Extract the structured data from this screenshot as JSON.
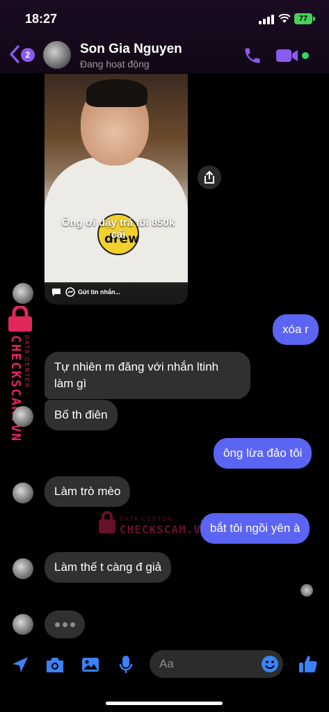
{
  "status_bar": {
    "time": "18:27",
    "battery": "77"
  },
  "header": {
    "unread_count": "2",
    "contact_name": "Son Gia Nguyen",
    "contact_status": "Đang hoạt động"
  },
  "shared_post": {
    "caption": "Ông ơi dậy trả tôi 850k cái",
    "shirt_text": "drew",
    "footer_text": "Gửi tin nhắn..."
  },
  "messages": [
    {
      "side": "out",
      "text": "xóa r"
    },
    {
      "side": "in",
      "text": "Tự nhiên m đăng với nhắn ltinh làm gì"
    },
    {
      "side": "in",
      "text": "Bố th điên"
    },
    {
      "side": "out",
      "text": "ông lừa đảo tôi"
    },
    {
      "side": "in",
      "text": "Làm trò mèo"
    },
    {
      "side": "out",
      "text": "bắt tôi ngồi yên à"
    },
    {
      "side": "in",
      "text": "Làm thế t càng đ giả"
    }
  ],
  "watermark": {
    "brand": "CHECKSCAM.VN",
    "sub": "DATA CENTER"
  },
  "composer": {
    "placeholder": "Aa"
  },
  "colors": {
    "accent": "#8a5bf0",
    "outgoing_bubble": "#5c64f4",
    "incoming_bubble": "#303030",
    "online": "#36d266",
    "watermark": "#e0275c"
  }
}
